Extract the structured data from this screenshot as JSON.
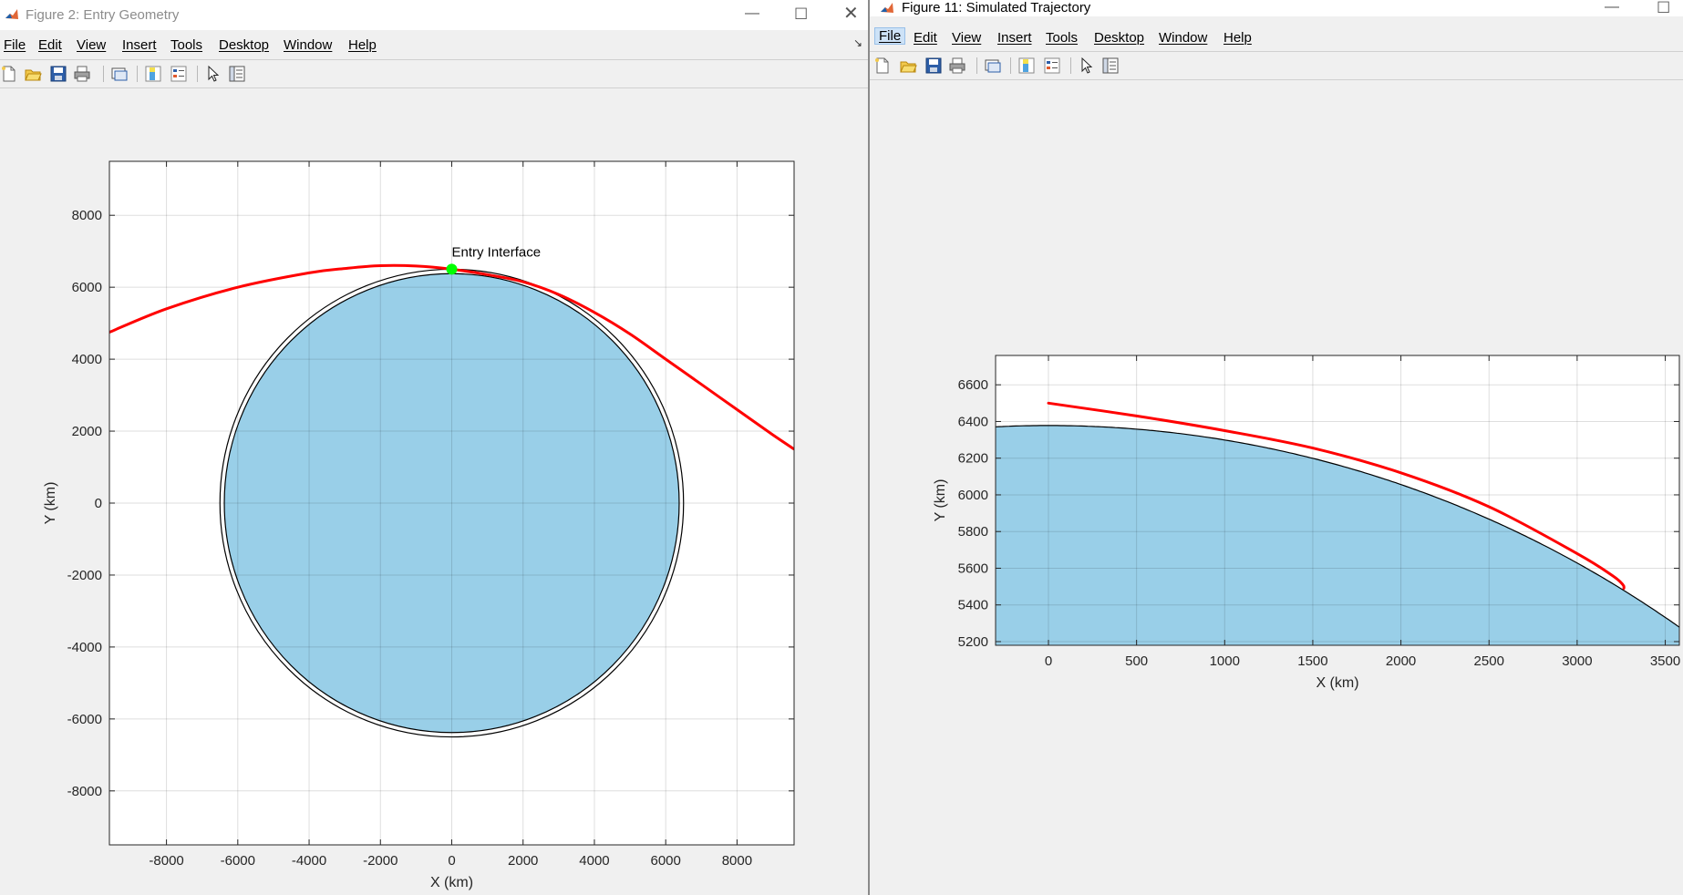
{
  "windows": [
    {
      "title": "Figure 2: Entry Geometry",
      "menu": [
        "File",
        "Edit",
        "View",
        "Insert",
        "Tools",
        "Desktop",
        "Window",
        "Help"
      ],
      "toolbar_icons": [
        "new-figure-icon",
        "open-icon",
        "save-icon",
        "print-icon",
        "link-plot-icon",
        "colorbar-icon",
        "legend-icon",
        "edit-pointer-icon",
        "property-inspector-icon"
      ]
    },
    {
      "title": "Figure 11: Simulated Trajectory",
      "menu": [
        "File",
        "Edit",
        "View",
        "Insert",
        "Tools",
        "Desktop",
        "Window",
        "Help"
      ],
      "active_menu": "File",
      "toolbar_icons": [
        "new-figure-icon",
        "open-icon",
        "save-icon",
        "print-icon",
        "link-plot-icon",
        "colorbar-icon",
        "legend-icon",
        "edit-pointer-icon",
        "property-inspector-icon"
      ]
    }
  ],
  "colors": {
    "earth_fill": "#99cfe8",
    "trajectory": "#ff0000",
    "entry_marker": "#00ff00"
  },
  "chart_data": [
    {
      "type": "line",
      "title": "",
      "xlabel": "X (km)",
      "ylabel": "Y (km)",
      "xlim": [
        -9600,
        9600
      ],
      "ylim": [
        -9500,
        9500
      ],
      "xticks": [
        -8000,
        -6000,
        -4000,
        -2000,
        0,
        2000,
        4000,
        6000,
        8000
      ],
      "yticks": [
        -8000,
        -6000,
        -4000,
        -2000,
        0,
        2000,
        4000,
        6000,
        8000
      ],
      "grid": true,
      "earth_radius": 6378,
      "atmosphere_radius": 6500,
      "series": [
        {
          "x": [
            -9600,
            -8000,
            -6000,
            -4000,
            -3000,
            -2000,
            -1000,
            0,
            1000,
            2000,
            3000,
            4000,
            5000,
            6000,
            7000,
            8000,
            9000,
            9600
          ],
          "y": [
            4750,
            5400,
            6000,
            6400,
            6520,
            6600,
            6590,
            6500,
            6350,
            6150,
            5800,
            5300,
            4700,
            4000,
            3300,
            2600,
            1900,
            1500
          ]
        }
      ],
      "annotation": {
        "text": "Entry Interface",
        "x": 0,
        "y": 6500
      }
    },
    {
      "type": "line",
      "title": "",
      "xlabel": "X (km)",
      "ylabel": "Y (km)",
      "xlim": [
        -300,
        3580
      ],
      "ylim": [
        5180,
        6760
      ],
      "xticks": [
        0,
        500,
        1000,
        1500,
        2000,
        2500,
        3000,
        3500
      ],
      "yticks": [
        5200,
        5400,
        5600,
        5800,
        6000,
        6200,
        6400,
        6600
      ],
      "grid": true,
      "earth_radius": 6378,
      "series": [
        {
          "x": [
            0,
            500,
            1000,
            1500,
            2000,
            2500,
            3000,
            3200,
            3260,
            3265
          ],
          "y": [
            6500,
            6430,
            6350,
            6255,
            6120,
            5935,
            5680,
            5560,
            5510,
            5490
          ]
        }
      ]
    }
  ]
}
